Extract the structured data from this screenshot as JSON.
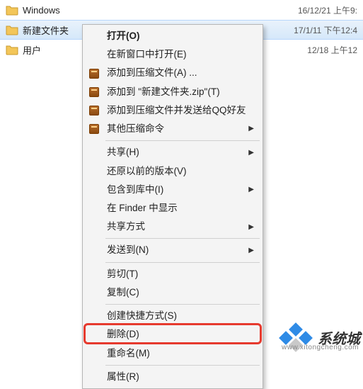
{
  "files": [
    {
      "name": "Windows",
      "date": "16/12/21 上午9:",
      "selected": false
    },
    {
      "name": "新建文件夹",
      "date": "17/1/11 下午12:4",
      "selected": true
    },
    {
      "name": "用户",
      "date": "12/18 上午12",
      "selected": false
    }
  ],
  "menu": {
    "open": "打开(O)",
    "open_new_window": "在新窗口中打开(E)",
    "add_to_archive": "添加到压缩文件(A) ...",
    "add_to_named_zip": "添加到 \"新建文件夹.zip\"(T)",
    "compress_send_qq": "添加到压缩文件并发送给QQ好友",
    "other_compress": "其他压缩命令",
    "share_h": "共享(H)",
    "restore_versions": "还原以前的版本(V)",
    "include_in_library": "包含到库中(I)",
    "show_in_finder": "在 Finder 中显示",
    "share_ways": "共享方式",
    "send_to": "发送到(N)",
    "cut": "剪切(T)",
    "copy": "复制(C)",
    "create_shortcut": "创建快捷方式(S)",
    "delete": "删除(D)",
    "rename": "重命名(M)",
    "properties": "属性(R)"
  },
  "watermark": {
    "text": "系统城",
    "url": "www.xitongcheng.com"
  }
}
